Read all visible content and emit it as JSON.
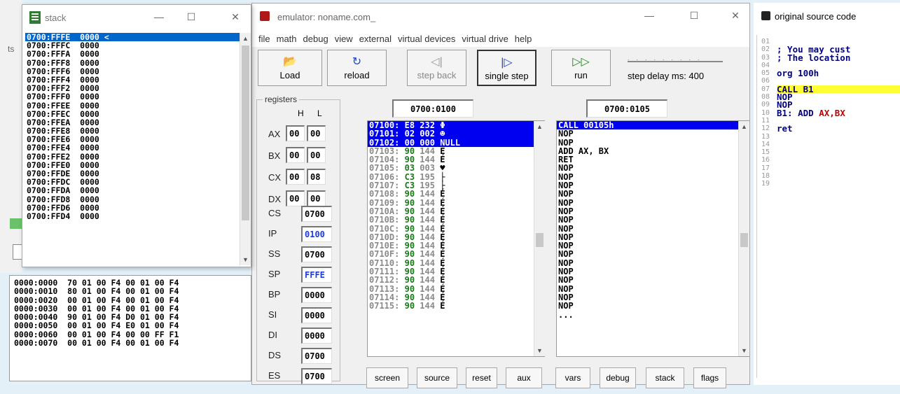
{
  "left_fragment": {
    "text": "ts"
  },
  "stack_window": {
    "title": "stack",
    "rows": [
      "0700:FFFE  0000 <",
      "0700:FFFC  0000",
      "0700:FFFA  0000",
      "0700:FFF8  0000",
      "0700:FFF6  0000",
      "0700:FFF4  0000",
      "0700:FFF2  0000",
      "0700:FFF0  0000",
      "0700:FFEE  0000",
      "0700:FFEC  0000",
      "0700:FFEA  0000",
      "0700:FFE8  0000",
      "0700:FFE6  0000",
      "0700:FFE4  0000",
      "0700:FFE2  0000",
      "0700:FFE0  0000",
      "0700:FFDE  0000",
      "0700:FFDC  0000",
      "0700:FFDA  0000",
      "0700:FFD8  0000",
      "0700:FFD6  0000",
      "0700:FFD4  0000"
    ]
  },
  "memory_dump": {
    "rows": [
      "0000:0000  70 01 00 F4 00 01 00 F4",
      "0000:0010  80 01 00 F4 00 01 00 F4",
      "0000:0020  00 01 00 F4 00 01 00 F4",
      "0000:0030  00 01 00 F4 00 01 00 F4",
      "0000:0040  90 01 00 F4 D0 01 00 F4",
      "0000:0050  00 01 00 F4 E0 01 00 F4",
      "0000:0060  00 01 00 F4 00 00 FF F1",
      "0000:0070  00 01 00 F4 00 01 00 F4"
    ]
  },
  "emulator": {
    "title": "emulator: noname.com_",
    "menu": [
      "file",
      "math",
      "debug",
      "view",
      "external",
      "virtual devices",
      "virtual drive",
      "help"
    ],
    "toolbar": {
      "load": "Load",
      "reload": "reload",
      "step_back": "step back",
      "single_step": "single step",
      "run": "run",
      "step_delay": "step delay ms: 400"
    },
    "registers_label": "registers",
    "col_h": "H",
    "col_l": "L",
    "regs_hl": [
      {
        "name": "AX",
        "h": "00",
        "l": "00"
      },
      {
        "name": "BX",
        "h": "00",
        "l": "00"
      },
      {
        "name": "CX",
        "h": "00",
        "l": "08"
      },
      {
        "name": "DX",
        "h": "00",
        "l": "00"
      }
    ],
    "regs_16": [
      {
        "name": "CS",
        "value": "0700",
        "blue": false
      },
      {
        "name": "IP",
        "value": "0100",
        "blue": true
      },
      {
        "name": "SS",
        "value": "0700",
        "blue": false
      },
      {
        "name": "SP",
        "value": "FFFE",
        "blue": true
      },
      {
        "name": "BP",
        "value": "0000",
        "blue": false
      },
      {
        "name": "SI",
        "value": "0000",
        "blue": false
      },
      {
        "name": "DI",
        "value": "0000",
        "blue": false
      },
      {
        "name": "DS",
        "value": "0700",
        "blue": false
      },
      {
        "name": "ES",
        "value": "0700",
        "blue": false
      }
    ],
    "addr_left": "0700:0100",
    "addr_right": "0700:0105",
    "memory_rows": [
      {
        "addr": "07100:",
        "hex": "E8",
        "dec": "232",
        "ch": "Φ",
        "sel": true
      },
      {
        "addr": "07101:",
        "hex": "02",
        "dec": "002",
        "ch": "☻",
        "sel": true
      },
      {
        "addr": "07102:",
        "hex": "00",
        "dec": "000",
        "ch": "NULL",
        "sel": true
      },
      {
        "addr": "07103:",
        "hex": "90",
        "dec": "144",
        "ch": "É",
        "sel": false
      },
      {
        "addr": "07104:",
        "hex": "90",
        "dec": "144",
        "ch": "É",
        "sel": false
      },
      {
        "addr": "07105:",
        "hex": "03",
        "dec": "003",
        "ch": "♥",
        "sel": false
      },
      {
        "addr": "07106:",
        "hex": "C3",
        "dec": "195",
        "ch": "├",
        "sel": false
      },
      {
        "addr": "07107:",
        "hex": "C3",
        "dec": "195",
        "ch": "├",
        "sel": false
      },
      {
        "addr": "07108:",
        "hex": "90",
        "dec": "144",
        "ch": "É",
        "sel": false
      },
      {
        "addr": "07109:",
        "hex": "90",
        "dec": "144",
        "ch": "É",
        "sel": false
      },
      {
        "addr": "0710A:",
        "hex": "90",
        "dec": "144",
        "ch": "É",
        "sel": false
      },
      {
        "addr": "0710B:",
        "hex": "90",
        "dec": "144",
        "ch": "É",
        "sel": false
      },
      {
        "addr": "0710C:",
        "hex": "90",
        "dec": "144",
        "ch": "É",
        "sel": false
      },
      {
        "addr": "0710D:",
        "hex": "90",
        "dec": "144",
        "ch": "É",
        "sel": false
      },
      {
        "addr": "0710E:",
        "hex": "90",
        "dec": "144",
        "ch": "É",
        "sel": false
      },
      {
        "addr": "0710F:",
        "hex": "90",
        "dec": "144",
        "ch": "É",
        "sel": false
      },
      {
        "addr": "07110:",
        "hex": "90",
        "dec": "144",
        "ch": "É",
        "sel": false
      },
      {
        "addr": "07111:",
        "hex": "90",
        "dec": "144",
        "ch": "É",
        "sel": false
      },
      {
        "addr": "07112:",
        "hex": "90",
        "dec": "144",
        "ch": "É",
        "sel": false
      },
      {
        "addr": "07113:",
        "hex": "90",
        "dec": "144",
        "ch": "É",
        "sel": false
      },
      {
        "addr": "07114:",
        "hex": "90",
        "dec": "144",
        "ch": "É",
        "sel": false
      },
      {
        "addr": "07115:",
        "hex": "90",
        "dec": "144",
        "ch": "É",
        "sel": false
      }
    ],
    "disasm_rows": [
      {
        "text": "CALL 00105h",
        "sel": true
      },
      {
        "text": "NOP",
        "sel": false
      },
      {
        "text": "NOP",
        "sel": false
      },
      {
        "text": "ADD AX, BX",
        "sel": false
      },
      {
        "text": "RET",
        "sel": false
      },
      {
        "text": "NOP",
        "sel": false
      },
      {
        "text": "NOP",
        "sel": false
      },
      {
        "text": "NOP",
        "sel": false
      },
      {
        "text": "NOP",
        "sel": false
      },
      {
        "text": "NOP",
        "sel": false
      },
      {
        "text": "NOP",
        "sel": false
      },
      {
        "text": "NOP",
        "sel": false
      },
      {
        "text": "NOP",
        "sel": false
      },
      {
        "text": "NOP",
        "sel": false
      },
      {
        "text": "NOP",
        "sel": false
      },
      {
        "text": "NOP",
        "sel": false
      },
      {
        "text": "NOP",
        "sel": false
      },
      {
        "text": "NOP",
        "sel": false
      },
      {
        "text": "NOP",
        "sel": false
      },
      {
        "text": "NOP",
        "sel": false
      },
      {
        "text": "NOP",
        "sel": false
      },
      {
        "text": "NOP",
        "sel": false
      },
      {
        "text": "...",
        "sel": false
      }
    ],
    "bottom_tabs": [
      "screen",
      "source",
      "reset",
      "aux",
      "vars",
      "debug",
      "stack",
      "flags"
    ]
  },
  "source_window": {
    "title": "original source code",
    "line_numbers": [
      "01",
      "02",
      "03",
      "04",
      "05",
      "06",
      "07",
      "08",
      "09",
      "10",
      "11",
      "12",
      "13",
      "14",
      "15",
      "16",
      "17",
      "18",
      "19"
    ],
    "lines": [
      "",
      "; You may cust",
      "; The location",
      "",
      "org 100h",
      "",
      "CALL B1",
      "NOP",
      "NOP",
      "B1: ADD AX,BX",
      "",
      "ret",
      "",
      "",
      "",
      "",
      "",
      "",
      ""
    ],
    "highlighted_line": 6
  },
  "colors": {
    "selection_blue": "#0000f0",
    "stack_selection": "#0066cc",
    "register_blue": "#1d3bd6",
    "hex_green": "#1a7a1a",
    "source_highlight": "#ffff33"
  }
}
